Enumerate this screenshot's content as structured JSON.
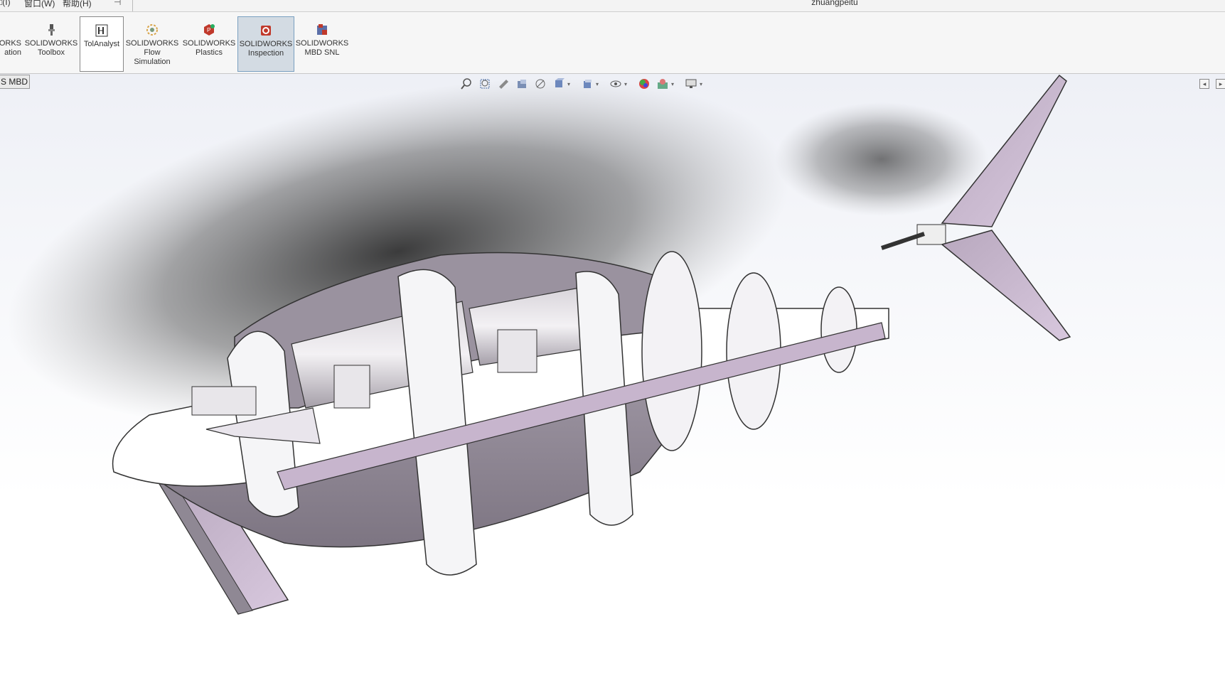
{
  "menu": {
    "items": [
      {
        "label": "窗口(W)"
      },
      {
        "label": "帮助(H)"
      }
    ],
    "partial_left": "□(I)",
    "pin_icon": "pushpin-icon"
  },
  "window": {
    "title": "zhuangpeitu"
  },
  "ribbon": {
    "buttons": [
      {
        "id": "partial",
        "lines": [
          "ORKS",
          "ation"
        ],
        "icon": "addin-icon"
      },
      {
        "id": "toolbox",
        "lines": [
          "SOLIDWORKS",
          "Toolbox"
        ],
        "icon": "toolbox-icon"
      },
      {
        "id": "tolanalyst",
        "lines": [
          "TolAnalyst"
        ],
        "icon": "tolanalyst-icon"
      },
      {
        "id": "flow",
        "lines": [
          "SOLIDWORKS",
          "Flow",
          "Simulation"
        ],
        "icon": "flow-simulation-icon"
      },
      {
        "id": "plastics",
        "lines": [
          "SOLIDWORKS",
          "Plastics"
        ],
        "icon": "plastics-icon"
      },
      {
        "id": "inspection",
        "lines": [
          "SOLIDWORKS",
          "Inspection"
        ],
        "icon": "inspection-icon"
      },
      {
        "id": "mbdsnl",
        "lines": [
          "SOLIDWORKS",
          "MBD SNL"
        ],
        "icon": "mbd-snl-icon"
      }
    ]
  },
  "tabs": {
    "mbd": "S MBD"
  },
  "heads_up_toolbar": {
    "icons": [
      "zoom-to-fit-icon",
      "zoom-to-area-icon",
      "previous-view-icon",
      "section-view-icon",
      "dynamic-annotation-icon",
      "view-orientation-icon",
      "display-style-icon",
      "hide-show-items-icon",
      "edit-appearance-icon",
      "apply-scene-icon",
      "view-settings-icon"
    ]
  },
  "colors": {
    "body": "#ffffff",
    "hull_side": "#8f8894",
    "hull_shadow": "#2a2a2a",
    "fin": "#c9b9cf",
    "ribbon_active": "#d3dbe3"
  }
}
